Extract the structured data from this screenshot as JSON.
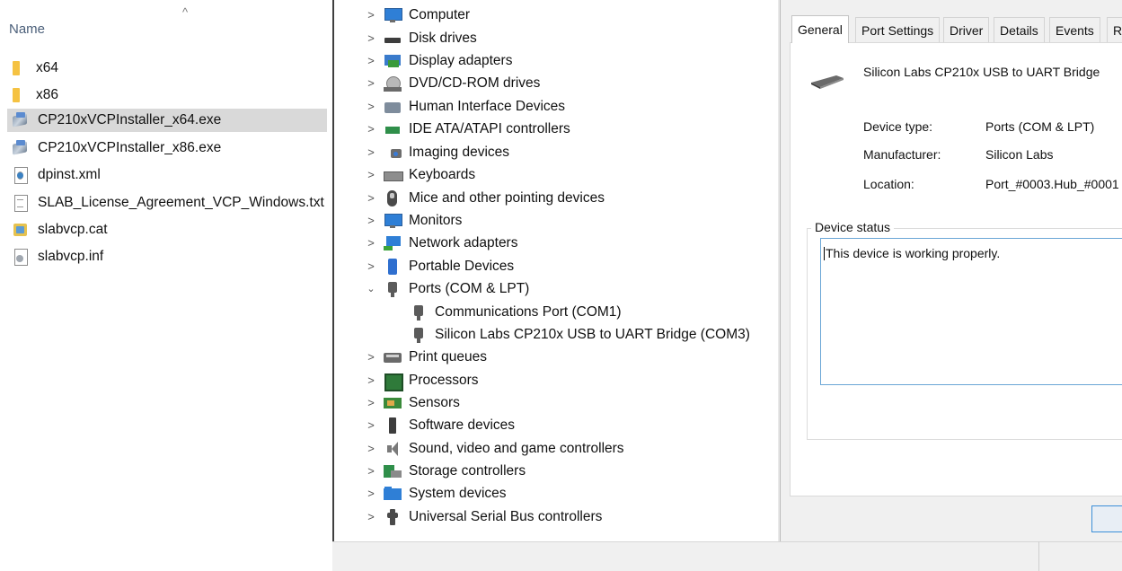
{
  "explorer": {
    "column_header": "Name",
    "sort_indicator": "^",
    "files": [
      {
        "name": "x64",
        "icon": "folder-icon"
      },
      {
        "name": "x86",
        "icon": "folder-icon"
      },
      {
        "name": "CP210xVCPInstaller_x64.exe",
        "icon": "installer-icon",
        "selected": true
      },
      {
        "name": "CP210xVCPInstaller_x86.exe",
        "icon": "installer-icon"
      },
      {
        "name": "dpinst.xml",
        "icon": "xml-file-icon"
      },
      {
        "name": "SLAB_License_Agreement_VCP_Windows.txt",
        "icon": "text-file-icon"
      },
      {
        "name": "slabvcp.cat",
        "icon": "catalog-file-icon"
      },
      {
        "name": "slabvcp.inf",
        "icon": "setup-info-file-icon"
      }
    ]
  },
  "device_manager": {
    "categories": [
      {
        "label": "Computer",
        "icon": "computer-icon",
        "expanded": false
      },
      {
        "label": "Disk drives",
        "icon": "disk-drive-icon",
        "expanded": false
      },
      {
        "label": "Display adapters",
        "icon": "display-adapter-icon",
        "expanded": false
      },
      {
        "label": "DVD/CD-ROM drives",
        "icon": "dvd-drive-icon",
        "expanded": false
      },
      {
        "label": "Human Interface Devices",
        "icon": "hid-icon",
        "expanded": false
      },
      {
        "label": "IDE ATA/ATAPI controllers",
        "icon": "ide-controller-icon",
        "expanded": false
      },
      {
        "label": "Imaging devices",
        "icon": "camera-icon",
        "expanded": false
      },
      {
        "label": "Keyboards",
        "icon": "keyboard-icon",
        "expanded": false
      },
      {
        "label": "Mice and other pointing devices",
        "icon": "mouse-icon",
        "expanded": false
      },
      {
        "label": "Monitors",
        "icon": "monitor-icon",
        "expanded": false
      },
      {
        "label": "Network adapters",
        "icon": "network-adapter-icon",
        "expanded": false
      },
      {
        "label": "Portable Devices",
        "icon": "portable-device-icon",
        "expanded": false
      },
      {
        "label": "Ports (COM & LPT)",
        "icon": "port-icon",
        "expanded": true
      },
      {
        "label": "Communications Port (COM1)",
        "icon": "port-icon",
        "child": true
      },
      {
        "label": "Silicon Labs CP210x USB to UART Bridge (COM3)",
        "icon": "port-icon",
        "child": true
      },
      {
        "label": "Print queues",
        "icon": "printer-icon",
        "expanded": false
      },
      {
        "label": "Processors",
        "icon": "processor-icon",
        "expanded": false
      },
      {
        "label": "Sensors",
        "icon": "sensor-icon",
        "expanded": false
      },
      {
        "label": "Software devices",
        "icon": "software-device-icon",
        "expanded": false
      },
      {
        "label": "Sound, video and game controllers",
        "icon": "speaker-icon",
        "expanded": false
      },
      {
        "label": "Storage controllers",
        "icon": "storage-controller-icon",
        "expanded": false
      },
      {
        "label": "System devices",
        "icon": "system-folder-icon",
        "expanded": false
      },
      {
        "label": "Universal Serial Bus controllers",
        "icon": "usb-icon",
        "expanded": false
      }
    ]
  },
  "properties": {
    "tabs": [
      "General",
      "Port Settings",
      "Driver",
      "Details",
      "Events",
      "R"
    ],
    "active_tab": "General",
    "device_name": "Silicon Labs CP210x USB to UART Bridge",
    "fields": [
      {
        "label": "Device type:",
        "value": "Ports (COM & LPT)"
      },
      {
        "label": "Manufacturer:",
        "value": "Silicon Labs"
      },
      {
        "label": "Location:",
        "value": "Port_#0003.Hub_#0001"
      }
    ],
    "status_group_title": "Device status",
    "status_text": "This device is working properly."
  },
  "colors": {
    "selection": "#d9d9d9",
    "folder": "#f5c242",
    "dialog_bg": "#f0f0f0",
    "focus_border": "#6aa6d6"
  }
}
